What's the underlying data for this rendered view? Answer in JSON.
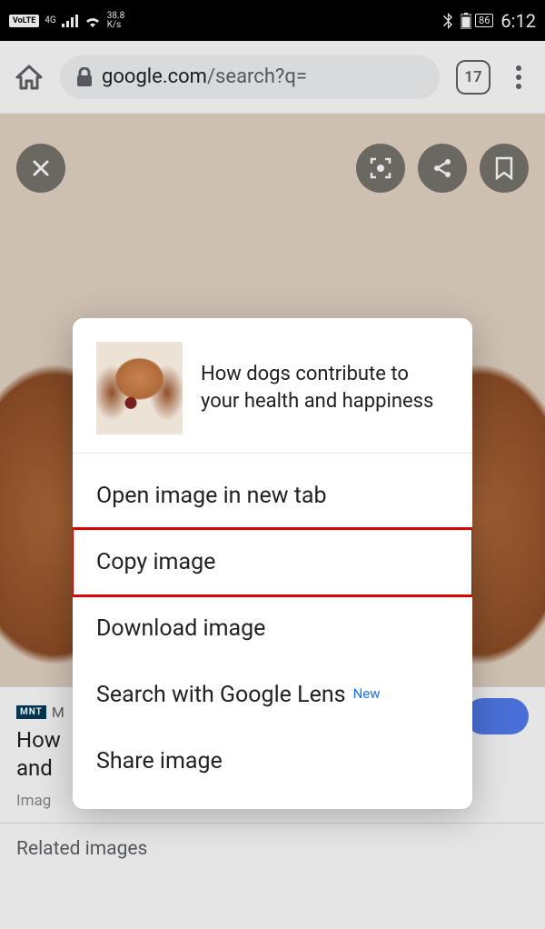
{
  "statusbar": {
    "volte": "VoLTE",
    "net_tech": "4G",
    "speed_top": "38.8",
    "speed_unit": "K/s",
    "battery_pct": "86",
    "clock": "6:12"
  },
  "url_bar": {
    "domain": "google.com",
    "path": "/search?q=",
    "tab_count": "17"
  },
  "article": {
    "source_abbrev": "MNT",
    "source_initial": "M",
    "title_line1": "How",
    "title_line2": "and ",
    "meta": "Imag",
    "related_label": "Related images"
  },
  "context_menu": {
    "title": "How dogs contribute to your health and happiness",
    "items": [
      {
        "label": "Open image in new tab",
        "highlight": false,
        "badge": ""
      },
      {
        "label": "Copy image",
        "highlight": true,
        "badge": ""
      },
      {
        "label": "Download image",
        "highlight": false,
        "badge": ""
      },
      {
        "label": "Search with Google Lens",
        "highlight": false,
        "badge": "New"
      },
      {
        "label": "Share image",
        "highlight": false,
        "badge": ""
      }
    ]
  }
}
